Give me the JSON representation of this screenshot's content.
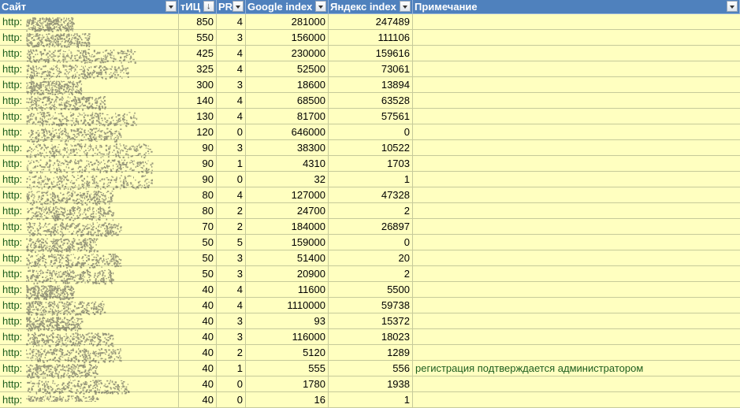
{
  "columns": [
    {
      "label": "Сайт",
      "sorted": false
    },
    {
      "label": "тИЦ",
      "sorted": true
    },
    {
      "label": "PR",
      "sorted": false
    },
    {
      "label": "Google index",
      "sorted": false
    },
    {
      "label": "Яндекс index",
      "sorted": false
    },
    {
      "label": "Примечание",
      "sorted": false
    }
  ],
  "rows": [
    {
      "site": "http:",
      "tic": "850",
      "pr": "4",
      "google": "281000",
      "yandex": "247489",
      "note": ""
    },
    {
      "site": "http:",
      "tic": "550",
      "pr": "3",
      "google": "156000",
      "yandex": "111106",
      "note": ""
    },
    {
      "site": "http:",
      "tic": "425",
      "pr": "4",
      "google": "230000",
      "yandex": "159616",
      "note": ""
    },
    {
      "site": "http:",
      "tic": "325",
      "pr": "4",
      "google": "52500",
      "yandex": "73061",
      "note": ""
    },
    {
      "site": "http:",
      "tic": "300",
      "pr": "3",
      "google": "18600",
      "yandex": "13894",
      "note": ""
    },
    {
      "site": "http:",
      "tic": "140",
      "pr": "4",
      "google": "68500",
      "yandex": "63528",
      "note": ""
    },
    {
      "site": "http:",
      "tic": "130",
      "pr": "4",
      "google": "81700",
      "yandex": "57561",
      "note": ""
    },
    {
      "site": "http:",
      "tic": "120",
      "pr": "0",
      "google": "646000",
      "yandex": "0",
      "note": ""
    },
    {
      "site": "http:",
      "tic": "90",
      "pr": "3",
      "google": "38300",
      "yandex": "10522",
      "note": ""
    },
    {
      "site": "http:",
      "tic": "90",
      "pr": "1",
      "google": "4310",
      "yandex": "1703",
      "note": ""
    },
    {
      "site": "http:",
      "tic": "90",
      "pr": "0",
      "google": "32",
      "yandex": "1",
      "note": ""
    },
    {
      "site": "http:",
      "tic": "80",
      "pr": "4",
      "google": "127000",
      "yandex": "47328",
      "note": ""
    },
    {
      "site": "http:",
      "tic": "80",
      "pr": "2",
      "google": "24700",
      "yandex": "2",
      "note": ""
    },
    {
      "site": "http:",
      "tic": "70",
      "pr": "2",
      "google": "184000",
      "yandex": "26897",
      "note": ""
    },
    {
      "site": "http:",
      "tic": "50",
      "pr": "5",
      "google": "159000",
      "yandex": "0",
      "note": ""
    },
    {
      "site": "http:",
      "tic": "50",
      "pr": "3",
      "google": "51400",
      "yandex": "20",
      "note": ""
    },
    {
      "site": "http:",
      "tic": "50",
      "pr": "3",
      "google": "20900",
      "yandex": "2",
      "note": ""
    },
    {
      "site": "http:",
      "tic": "40",
      "pr": "4",
      "google": "11600",
      "yandex": "5500",
      "note": ""
    },
    {
      "site": "http:",
      "tic": "40",
      "pr": "4",
      "google": "1110000",
      "yandex": "59738",
      "note": ""
    },
    {
      "site": "http:",
      "tic": "40",
      "pr": "3",
      "google": "93",
      "yandex": "15372",
      "note": ""
    },
    {
      "site": "http:",
      "tic": "40",
      "pr": "3",
      "google": "116000",
      "yandex": "18023",
      "note": ""
    },
    {
      "site": "http:",
      "tic": "40",
      "pr": "2",
      "google": "5120",
      "yandex": "1289",
      "note": ""
    },
    {
      "site": "http:",
      "tic": "40",
      "pr": "1",
      "google": "555",
      "yandex": "556",
      "note": "регистрация подтверждается администратором"
    },
    {
      "site": "http:",
      "tic": "40",
      "pr": "0",
      "google": "1780",
      "yandex": "1938",
      "note": ""
    },
    {
      "site": "http:",
      "tic": "40",
      "pr": "0",
      "google": "16",
      "yandex": "1",
      "note": ""
    }
  ],
  "colors": {
    "header_bg": "#4f81bd",
    "row_bg": "#ffffc0",
    "link": "#1f5e1f"
  },
  "icons": {
    "filter": "filter-dropdown-icon",
    "sort": "sort-descending-icon"
  }
}
